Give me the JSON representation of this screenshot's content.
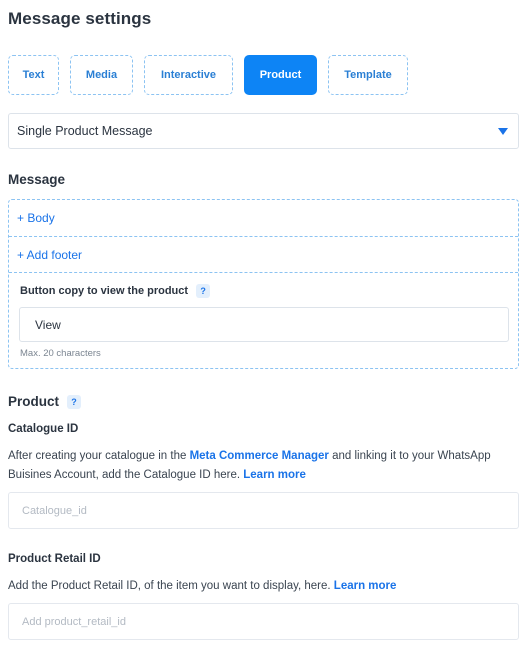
{
  "page": {
    "title": "Message settings"
  },
  "tabs": [
    {
      "label": "Text",
      "active": false
    },
    {
      "label": "Media",
      "active": false
    },
    {
      "label": "Interactive",
      "active": false
    },
    {
      "label": "Product",
      "active": true
    },
    {
      "label": "Template",
      "active": false
    }
  ],
  "message_type_select": {
    "value": "Single Product Message"
  },
  "message": {
    "section_title": "Message",
    "add_body": "+ Body",
    "add_footer": "+ Add footer",
    "button_copy_label": "Button copy to view the product",
    "button_copy_help": "?",
    "button_copy_value": "View",
    "button_copy_hint": "Max. 20 characters"
  },
  "product": {
    "section_title": "Product",
    "help": "?",
    "catalogue": {
      "label": "Catalogue ID",
      "desc_before": "After creating your catalogue in the ",
      "desc_link1": "Meta Commerce Manager",
      "desc_middle": " and linking it to your WhatsApp Buisines Account, add the Catalogue ID here. ",
      "desc_link2": "Learn more",
      "placeholder": "Catalogue_id"
    },
    "retail": {
      "label": "Product Retail ID",
      "desc_before": "Add the Product Retail ID, of the item you want to display, here. ",
      "desc_link": "Learn more",
      "placeholder": "Add product_retail_id"
    }
  },
  "colors": {
    "accent": "#0d84f5",
    "link": "#1a73e8",
    "dashed_border": "#8cc3f2"
  }
}
